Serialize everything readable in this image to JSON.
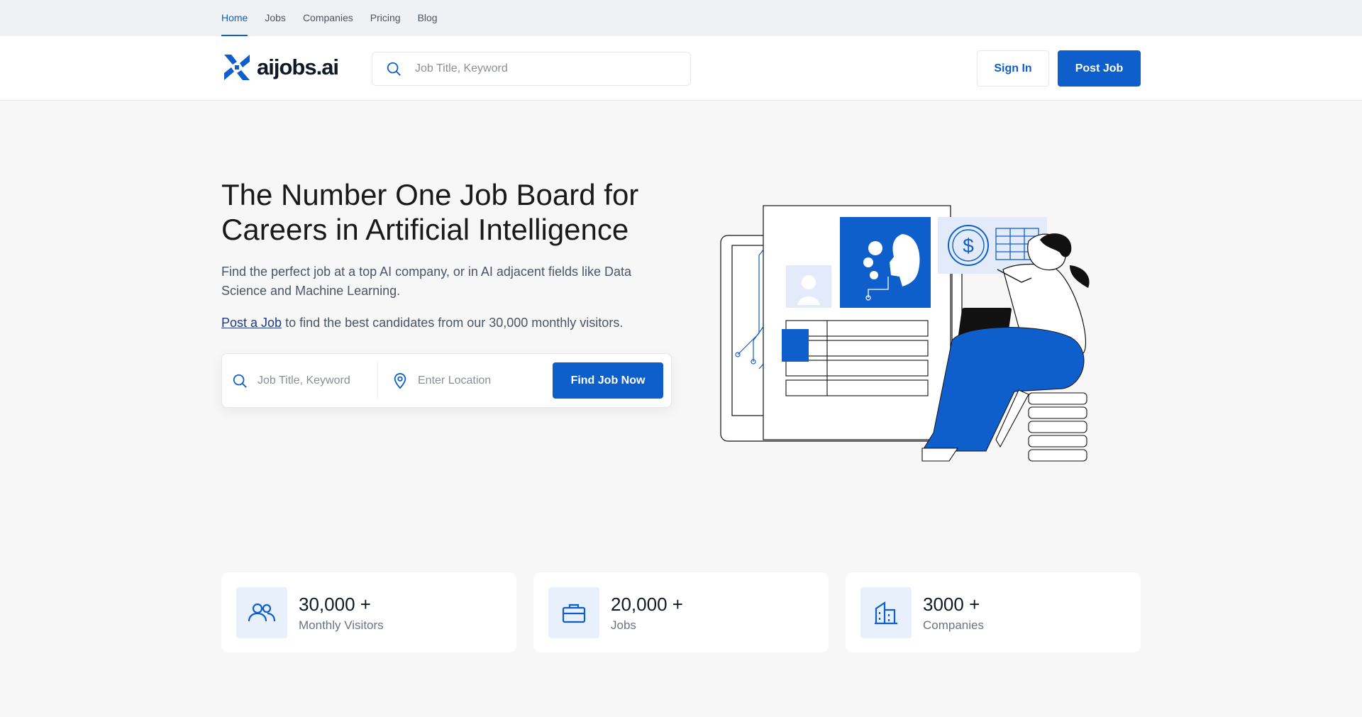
{
  "nav": {
    "items": [
      {
        "label": "Home",
        "active": true
      },
      {
        "label": "Jobs"
      },
      {
        "label": "Companies"
      },
      {
        "label": "Pricing"
      },
      {
        "label": "Blog"
      }
    ]
  },
  "header": {
    "logo_text": "aijobs.ai",
    "search_placeholder": "Job Title, Keyword",
    "signin_label": "Sign In",
    "post_job_label": "Post Job"
  },
  "hero": {
    "title": "The Number One Job Board for Careers in Artificial Intelligence",
    "subtitle": "Find the perfect job at a top AI company, or in AI adjacent fields like Data Science and Machine Learning.",
    "post_link": "Post a Job",
    "post_text": " to find the best candidates from our 30,000 monthly visitors.",
    "search": {
      "keyword_placeholder": "Job Title, Keyword",
      "location_placeholder": "Enter Location",
      "button_label": "Find Job Now"
    }
  },
  "stats": [
    {
      "value": "30,000 +",
      "label": "Monthly Visitors",
      "icon": "users-icon"
    },
    {
      "value": "20,000 +",
      "label": "Jobs",
      "icon": "briefcase-icon"
    },
    {
      "value": "3000 +",
      "label": "Companies",
      "icon": "building-icon"
    }
  ],
  "colors": {
    "accent": "#0e5fcc",
    "background": "#f7f7f8",
    "nav_bg": "#eff1f4"
  }
}
